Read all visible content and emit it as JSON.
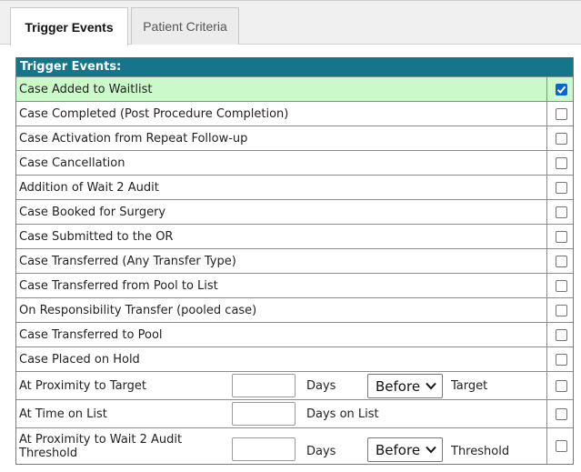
{
  "tabs": [
    {
      "label": "Trigger Events",
      "active": true
    },
    {
      "label": "Patient Criteria",
      "active": false
    }
  ],
  "table": {
    "header": "Trigger Events:",
    "rows": [
      {
        "label": "Case Added to Waitlist",
        "checked": true
      },
      {
        "label": "Case Completed (Post Procedure Completion)",
        "checked": false
      },
      {
        "label": "Case Activation from Repeat Follow-up",
        "checked": false
      },
      {
        "label": "Case Cancellation",
        "checked": false
      },
      {
        "label": "Addition of Wait 2 Audit",
        "checked": false
      },
      {
        "label": "Case Booked for Surgery",
        "checked": false
      },
      {
        "label": "Case Submitted to the OR",
        "checked": false
      },
      {
        "label": "Case Transferred (Any Transfer Type)",
        "checked": false
      },
      {
        "label": "Case Transferred from Pool to List",
        "checked": false
      },
      {
        "label": "On Responsibility Transfer (pooled case)",
        "checked": false
      },
      {
        "label": "Case Transferred to Pool",
        "checked": false
      },
      {
        "label": "Case Placed on Hold",
        "checked": false
      }
    ],
    "proximity_target": {
      "label": "At Proximity to Target",
      "days_value": "",
      "days_label": "Days",
      "direction": "Before",
      "suffix": "Target",
      "checked": false
    },
    "time_on_list": {
      "label": "At Time on List",
      "days_value": "",
      "days_label": "Days on List",
      "checked": false
    },
    "proximity_audit": {
      "label_line1": "At Proximity to Wait 2 Audit",
      "label_line2": "Threshold",
      "days_value": "",
      "days_label": "Days",
      "direction": "Before",
      "suffix": "Threshold",
      "checked": false
    }
  },
  "colors": {
    "header_bg": "#15758a",
    "selected_row_bg": "#ccf9c9",
    "checkbox_checked": "#0b63d6"
  }
}
